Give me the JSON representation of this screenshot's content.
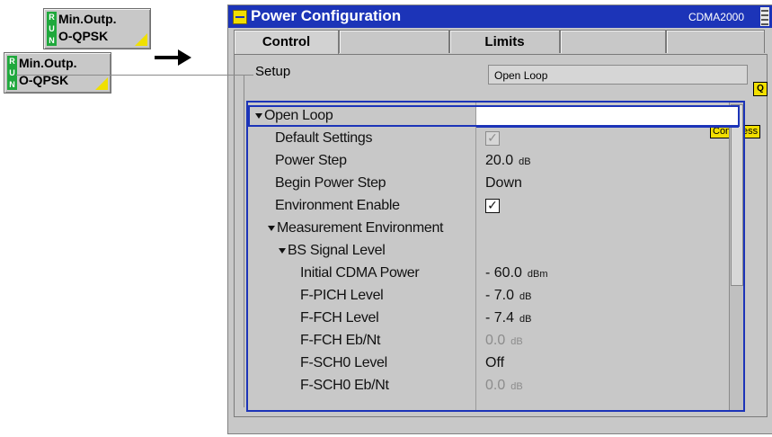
{
  "softkeys": [
    {
      "id": "back",
      "line1": "Min.Outp.",
      "line2": "O-QPSK",
      "run": [
        "R",
        "U",
        "N"
      ]
    },
    {
      "id": "front",
      "line1": "Min.Outp.",
      "line2": "O-QPSK",
      "run": [
        "R",
        "U",
        "N"
      ]
    }
  ],
  "window": {
    "title": "Power Configuration",
    "mode": "CDMA2000",
    "tabs": [
      "Control",
      "",
      "Limits",
      "",
      ""
    ]
  },
  "setup": {
    "label": "Setup",
    "value": "Open Loop",
    "q_badge": "Q",
    "compress_label": "Compress"
  },
  "tree": [
    {
      "label": "Open Loop",
      "value": "",
      "expandable": true,
      "level": 0,
      "selected": true
    },
    {
      "label": "Default Settings",
      "value": "",
      "checkbox": "grey",
      "level": 1
    },
    {
      "label": "Power Step",
      "value": "20.0",
      "unit": "dB",
      "level": 1
    },
    {
      "label": "Begin Power Step",
      "value": "Down",
      "level": 1
    },
    {
      "label": "Environment Enable",
      "value": "",
      "checkbox": "on",
      "level": 1
    },
    {
      "label": "Measurement Environment",
      "value": "",
      "expandable": true,
      "level": 1
    },
    {
      "label": "BS Signal Level",
      "value": "",
      "expandable": true,
      "level": 2
    },
    {
      "label": "Initial CDMA Power",
      "value": "- 60.0",
      "unit": "dBm",
      "level": 3
    },
    {
      "label": "F-PICH Level",
      "value": "- 7.0",
      "unit": "dB",
      "level": 3
    },
    {
      "label": "F-FCH Level",
      "value": "- 7.4",
      "unit": "dB",
      "level": 3
    },
    {
      "label": "F-FCH Eb/Nt",
      "value": "0.0",
      "unit": "dB",
      "level": 3,
      "dim": true
    },
    {
      "label": "F-SCH0 Level",
      "value": "Off",
      "level": 3
    },
    {
      "label": "F-SCH0 Eb/Nt",
      "value": "0.0",
      "unit": "dB",
      "level": 3,
      "dim": true
    }
  ],
  "colors": {
    "accent": "#1c34b8",
    "highlight": "#f2df00",
    "run_green": "#1fa83c"
  }
}
